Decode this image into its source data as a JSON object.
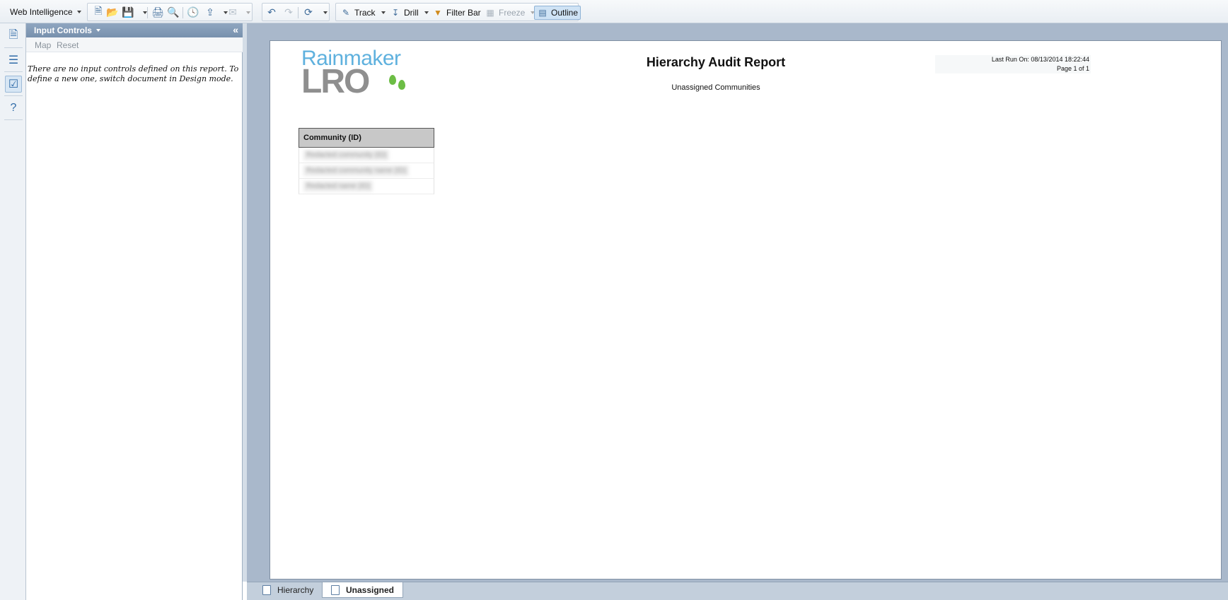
{
  "toolbar": {
    "app_menu_label": "Web Intelligence",
    "track_label": "Track",
    "drill_label": "Drill",
    "filter_bar_label": "Filter Bar",
    "freeze_label": "Freeze",
    "outline_label": "Outline",
    "icons": [
      "new-document-icon",
      "open-folder-icon",
      "save-icon",
      "print-icon",
      "find-icon",
      "history-icon",
      "export-icon",
      "email-icon",
      "undo-icon",
      "redo-icon",
      "refresh-icon"
    ]
  },
  "rail": {
    "icons": [
      "document-summary-icon",
      "navigation-map-icon",
      "input-controls-icon",
      "help-icon"
    ]
  },
  "panel": {
    "title": "Input Controls",
    "map_label": "Map",
    "reset_label": "Reset",
    "message": "There are no input controls defined on this report. To define a new one, switch document in Design mode."
  },
  "report": {
    "logo_top": "Rainmaker",
    "logo_bottom": "LRO",
    "title": "Hierarchy Audit Report",
    "subtitle": "Unassigned Communities",
    "last_run": "Last Run On: 08/13/2014 18:22:44",
    "page_info": "Page 1 of 1",
    "table": {
      "header": "Community (ID)",
      "rows": [
        "Redacted community (ID)",
        "Redacted community name (ID)",
        "Redacted name (ID)"
      ]
    }
  },
  "tabs": [
    {
      "label": "Hierarchy",
      "active": false
    },
    {
      "label": "Unassigned",
      "active": true
    }
  ],
  "colors": {
    "logo_blue": "#5fb1de",
    "logo_gray": "#8f8f8f",
    "logo_green": "#6cbd45",
    "panel_header": "#7790ad"
  }
}
